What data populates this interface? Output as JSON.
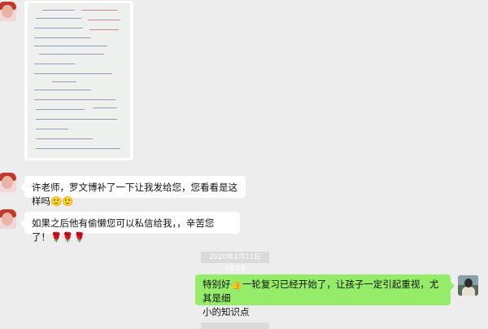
{
  "messages": [
    {
      "type": "image",
      "sender": "teacher",
      "alt_icon": "photo-of-handwritten-notes"
    },
    {
      "type": "text",
      "sender": "parent",
      "text": "许老师，罗文博补了一下让我发给您，您看看是这样吗🙂🙂"
    },
    {
      "type": "text",
      "sender": "parent",
      "text": "如果之后他有偷懒您可以私信给我，，辛苦您了！🌹🌹🌹"
    },
    {
      "type": "timestamp",
      "text": "2020年2月11日 08:18"
    },
    {
      "type": "text",
      "sender": "teacher",
      "line1": "特别好👍一轮复习已经开始了，让孩子一定引起重视，尤其是细",
      "line2": "小的知识点"
    }
  ],
  "colors": {
    "background": "#ededed",
    "incoming_bubble": "#ffffff",
    "outgoing_bubble": "#95ec69"
  }
}
